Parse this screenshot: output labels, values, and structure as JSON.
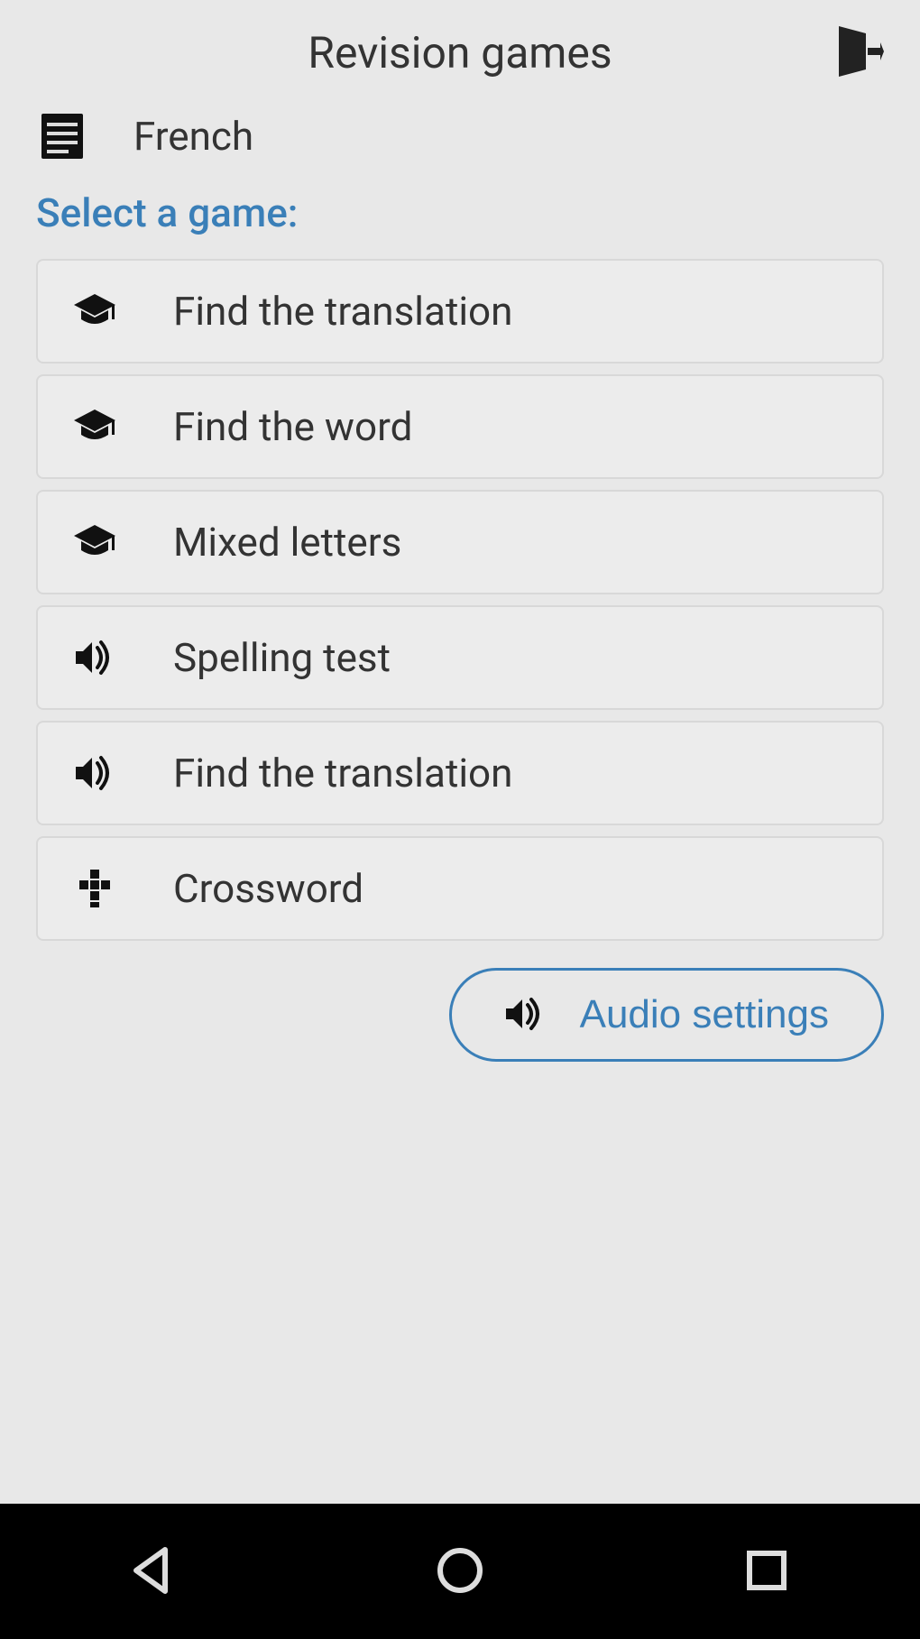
{
  "header": {
    "title": "Revision games"
  },
  "language": {
    "label": "French"
  },
  "subtitle": "Select a game:",
  "games": [
    {
      "icon": "grad-cap",
      "label": "Find the translation"
    },
    {
      "icon": "grad-cap",
      "label": "Find the word"
    },
    {
      "icon": "grad-cap",
      "label": "Mixed letters"
    },
    {
      "icon": "volume",
      "label": "Spelling test"
    },
    {
      "icon": "volume",
      "label": "Find the translation"
    },
    {
      "icon": "crossword",
      "label": "Crossword"
    }
  ],
  "audio_settings": {
    "label": "Audio settings"
  }
}
